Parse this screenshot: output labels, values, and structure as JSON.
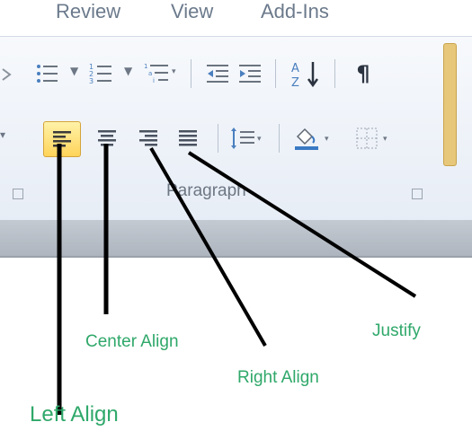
{
  "tabs": [
    "Review",
    "View",
    "Add-Ins"
  ],
  "group": {
    "label": "Paragraph"
  },
  "buttons": {
    "left_align": "Left Align",
    "center_align": "Center Align",
    "right_align": "Right Align",
    "justify": "Justify"
  },
  "annotations": {
    "left": "Left Align",
    "center": "Center Align",
    "right": "Right Align",
    "justify": "Justify"
  },
  "colors": {
    "label_green": "#2fa86a",
    "selected": "#ffd45a"
  }
}
